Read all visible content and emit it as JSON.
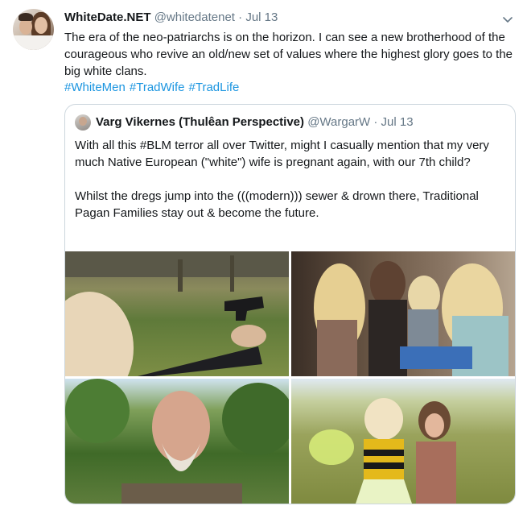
{
  "tweet": {
    "name": "WhiteDate.NET",
    "handle": "@whitedatenet",
    "separator": "·",
    "date": "Jul 13",
    "text": "The era of the neo-patriarchs is on the horizon. I can see a new brotherhood of the courageous who revive an old/new set of values where the highest glory goes to the big white clans.",
    "hashtags": [
      "#WhiteMen",
      "#TradWife",
      "#TradLife"
    ],
    "menu_icon": "chevron-down-icon"
  },
  "quoted": {
    "name": "Varg Vikernes (Thulêan Perspective)",
    "handle": "@WargarW",
    "separator": "·",
    "date": "Jul 13",
    "paragraphs": [
      "With all this #BLM terror all over Twitter, might I casually mention that my very much Native European (\"white\") wife is pregnant again, with our 7th child?",
      "Whilst the dregs jump into the (((modern))) sewer & drown there, Traditional Pagan Families stay out & become the future."
    ]
  },
  "colors": {
    "text": "#14171a",
    "secondary": "#657786",
    "link": "#1b95e0",
    "border": "#ccd6dd"
  }
}
